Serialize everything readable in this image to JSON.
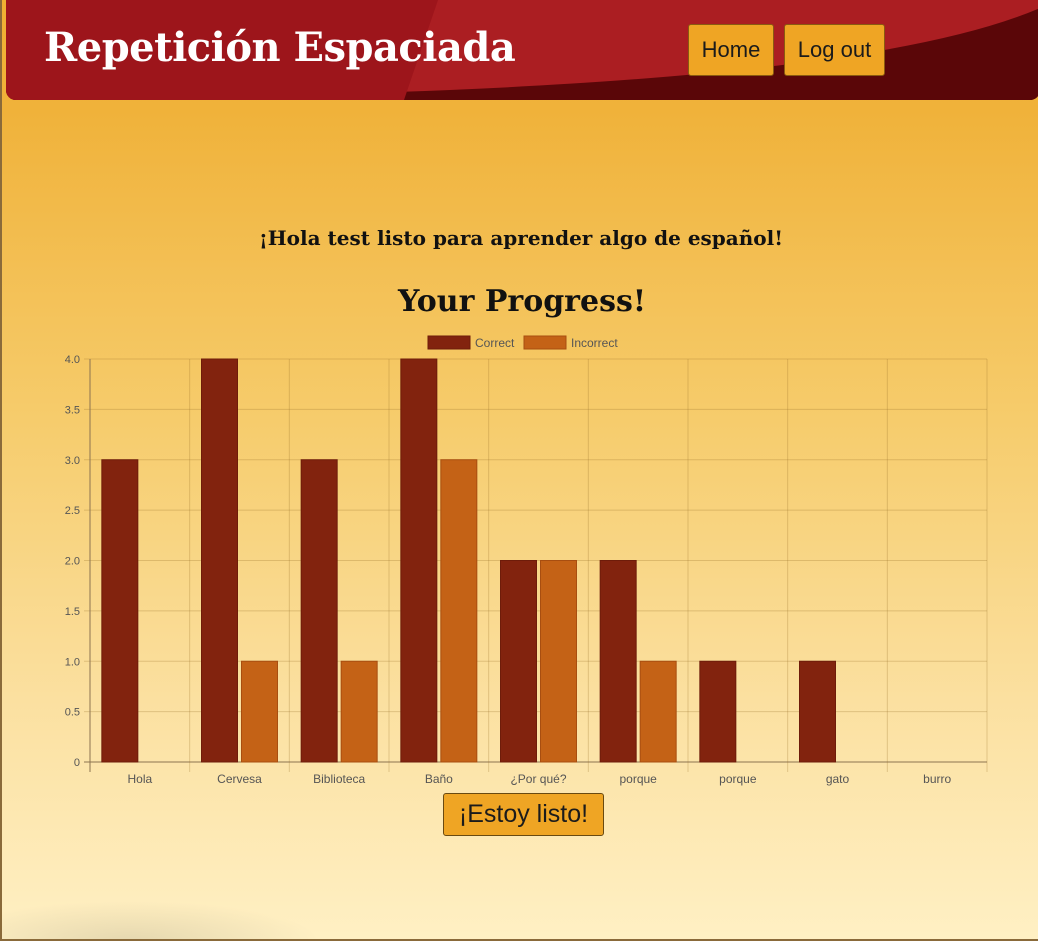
{
  "header": {
    "title": "Repetición Espaciada",
    "nav": {
      "home_label": "Home",
      "logout_label": "Log out"
    }
  },
  "main": {
    "greeting": "¡Hola test listo para aprender algo de español!",
    "progress_title": "Your Progress!",
    "ready_button_label": "¡Estoy listo!"
  },
  "colors": {
    "header_red": "#ab1e22",
    "header_dark": "#5a0608",
    "button_amber": "#efa524",
    "correct": "#82230e",
    "incorrect": "#c46216"
  },
  "chart_data": {
    "type": "bar",
    "title": "",
    "categories": [
      "Hola",
      "Cervesa",
      "Biblioteca",
      "Baño",
      "¿Por qué?",
      "porque",
      "porque",
      "gato",
      "burro"
    ],
    "series": [
      {
        "name": "Correct",
        "values": [
          3,
          4,
          3,
          4,
          2,
          2,
          1,
          1,
          0
        ]
      },
      {
        "name": "Incorrect",
        "values": [
          0,
          1,
          1,
          3,
          2,
          1,
          0,
          0,
          0
        ]
      }
    ],
    "ylim": [
      0,
      4
    ],
    "yticks": [
      "0",
      "0.5",
      "1.0",
      "1.5",
      "2.0",
      "2.5",
      "3.0",
      "3.5",
      "4.0"
    ],
    "grid": true,
    "legend": "top-center"
  }
}
